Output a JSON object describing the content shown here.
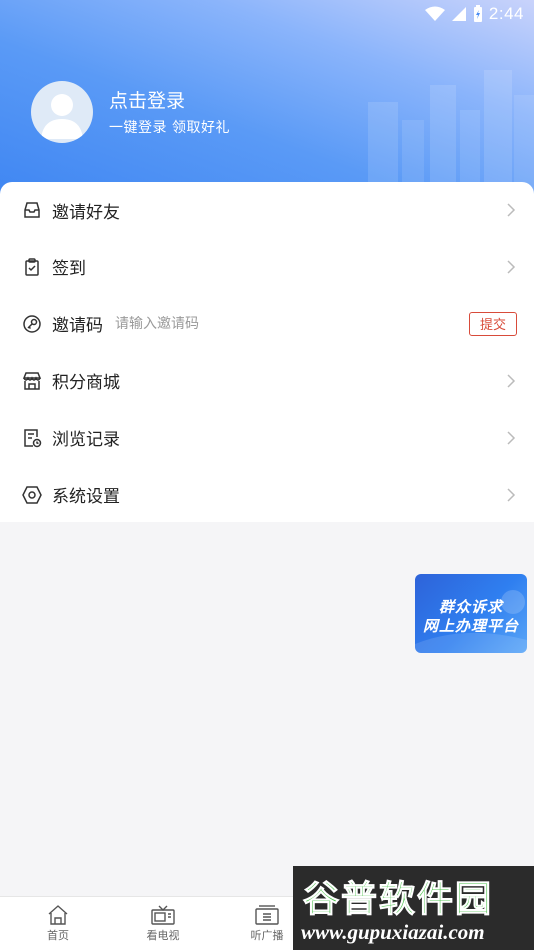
{
  "status_bar": {
    "time": "2:44"
  },
  "profile": {
    "title": "点击登录",
    "subtitle": "一键登录  领取好礼"
  },
  "menu": [
    {
      "label": "邀请好友",
      "icon": "inbox-icon"
    },
    {
      "label": "签到",
      "icon": "clipboard-check-icon"
    },
    {
      "label": "邀请码",
      "icon": "key-icon",
      "placeholder": "请输入邀请码",
      "button": "提交"
    },
    {
      "label": "积分商城",
      "icon": "store-icon"
    },
    {
      "label": "浏览记录",
      "icon": "history-doc-icon"
    },
    {
      "label": "系统设置",
      "icon": "settings-hex-icon"
    }
  ],
  "banner": {
    "line1": "群众诉求",
    "line2": "网上办理平台"
  },
  "tabbar": [
    {
      "label": "首页",
      "icon": "home-icon"
    },
    {
      "label": "看电视",
      "icon": "tv-icon"
    },
    {
      "label": "听广播",
      "icon": "radio-icon"
    }
  ],
  "watermark": {
    "title": "谷普软件园",
    "url": "www.gupuxiazai.com"
  },
  "colors": {
    "accent_red": "#d84b3a",
    "header_blue": "#3f86f2",
    "banner_blue": "#2f7ff0"
  }
}
